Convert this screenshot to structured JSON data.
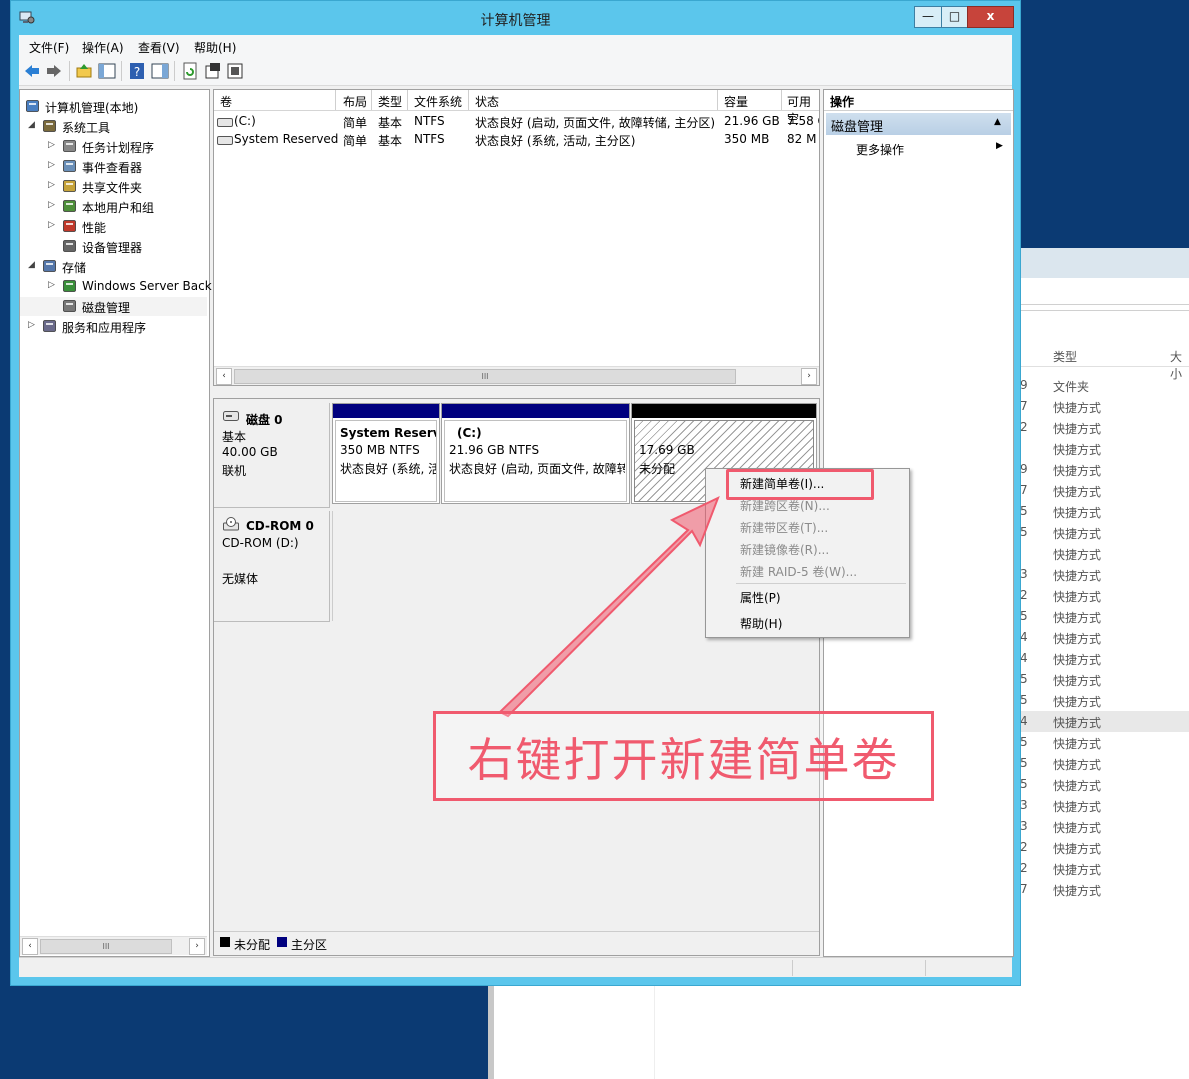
{
  "window": {
    "title": "计算机管理",
    "controls": {
      "minimize": "—",
      "maximize": "□",
      "close": "x"
    }
  },
  "menubar": [
    "文件(F)",
    "操作(A)",
    "查看(V)",
    "帮助(H)"
  ],
  "tree": {
    "items": [
      {
        "label": "计算机管理(本地)",
        "icon": "computer-management-icon"
      },
      {
        "label": "系统工具",
        "icon": "system-tools-icon"
      },
      {
        "label": "任务计划程序",
        "icon": "task-scheduler-icon"
      },
      {
        "label": "事件查看器",
        "icon": "event-viewer-icon"
      },
      {
        "label": "共享文件夹",
        "icon": "shared-folders-icon"
      },
      {
        "label": "本地用户和组",
        "icon": "users-icon"
      },
      {
        "label": "性能",
        "icon": "performance-icon"
      },
      {
        "label": "设备管理器",
        "icon": "device-manager-icon"
      },
      {
        "label": "存储",
        "icon": "storage-icon"
      },
      {
        "label": "Windows Server Back",
        "icon": "backup-icon"
      },
      {
        "label": "磁盘管理",
        "icon": "disk-management-icon"
      },
      {
        "label": "服务和应用程序",
        "icon": "services-icon"
      }
    ]
  },
  "list": {
    "columns": [
      "卷",
      "布局",
      "类型",
      "文件系统",
      "状态",
      "容量",
      "可用空"
    ],
    "rows": [
      {
        "vol": "(C:)",
        "layout": "简单",
        "type": "基本",
        "fs": "NTFS",
        "status": "状态良好 (启动, 页面文件, 故障转储, 主分区)",
        "cap": "21.96 GB",
        "free": "7.58 G"
      },
      {
        "vol": "System Reserved",
        "layout": "简单",
        "type": "基本",
        "fs": "NTFS",
        "status": "状态良好 (系统, 活动, 主分区)",
        "cap": "350 MB",
        "free": "82 M"
      }
    ]
  },
  "disks": [
    {
      "name": "磁盘 0",
      "type": "基本",
      "size": "40.00 GB",
      "state": "联机"
    },
    {
      "name": "CD-ROM 0",
      "type": "CD-ROM (D:)",
      "state": "无媒体"
    }
  ],
  "partitions": [
    {
      "name": "System Reserve",
      "size": "350 MB NTFS",
      "status": "状态良好 (系统, 活"
    },
    {
      "name": "(C:)",
      "size": "21.96 GB NTFS",
      "status": "状态良好 (启动, 页面文件, 故障转"
    },
    {
      "size": "17.69 GB",
      "status": "未分配"
    }
  ],
  "legend": {
    "unallocated": "未分配",
    "primary": "主分区"
  },
  "actions": {
    "header": "操作",
    "section": "磁盘管理",
    "more": "更多操作"
  },
  "context_menu": {
    "items": [
      {
        "label": "新建简单卷(I)...",
        "enabled": true
      },
      {
        "label": "新建跨区卷(N)...",
        "enabled": false
      },
      {
        "label": "新建带区卷(T)...",
        "enabled": false
      },
      {
        "label": "新建镜像卷(R)...",
        "enabled": false
      },
      {
        "label": "新建 RAID-5 卷(W)...",
        "enabled": false
      },
      {
        "label": "属性(P)",
        "enabled": true
      },
      {
        "label": "帮助(H)",
        "enabled": true
      }
    ]
  },
  "annotation": {
    "text": "右键打开新建简单卷",
    "color": "#f05a6e"
  },
  "background_window": {
    "column_type": "类型",
    "column_size": "大小",
    "rows": [
      {
        "n": "9",
        "t": "文件夹"
      },
      {
        "n": "7",
        "t": "快捷方式"
      },
      {
        "n": "2",
        "t": "快捷方式"
      },
      {
        "n": "",
        "t": "快捷方式"
      },
      {
        "n": "9",
        "t": "快捷方式"
      },
      {
        "n": "7",
        "t": "快捷方式"
      },
      {
        "n": "5",
        "t": "快捷方式"
      },
      {
        "n": "5",
        "t": "快捷方式"
      },
      {
        "n": "",
        "t": "快捷方式"
      },
      {
        "n": "3",
        "t": "快捷方式"
      },
      {
        "n": "2",
        "t": "快捷方式"
      },
      {
        "n": "5",
        "t": "快捷方式"
      },
      {
        "n": "4",
        "t": "快捷方式"
      },
      {
        "n": "4",
        "t": "快捷方式"
      },
      {
        "n": "5",
        "t": "快捷方式"
      },
      {
        "n": "5",
        "t": "快捷方式"
      },
      {
        "n": "4",
        "t": "快捷方式"
      },
      {
        "n": "5",
        "t": "快捷方式"
      },
      {
        "n": "5",
        "t": "快捷方式"
      },
      {
        "n": "5",
        "t": "快捷方式"
      },
      {
        "n": "3",
        "t": "快捷方式"
      },
      {
        "n": "3",
        "t": "快捷方式"
      },
      {
        "n": "2",
        "t": "快捷方式"
      },
      {
        "n": "2",
        "t": "快捷方式"
      },
      {
        "n": "7",
        "t": "快捷方式"
      }
    ]
  },
  "colors": {
    "primary_partition": "#00007f",
    "unallocated": "#000000",
    "titlebar": "#5bc6ec",
    "desktop": "#0b3a73"
  }
}
